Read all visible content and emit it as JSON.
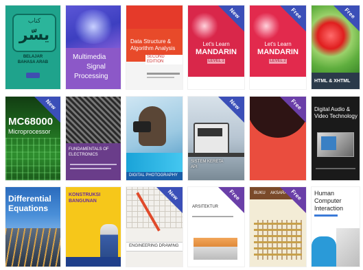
{
  "badges": {
    "new": "New",
    "free": "Free"
  },
  "books": [
    {
      "title_top": "كتاب",
      "title_main": "يسّر",
      "subtitle_1": "BELAJAR",
      "subtitle_2": "BAHASA ARAB"
    },
    {
      "title_line_1": "Multimedia",
      "title_line_2": "Signal",
      "title_line_3": "Processing"
    },
    {
      "title_line_1": "Data Structure &",
      "title_line_2": "Algorithm Analysis",
      "edition": "SECOND EDITION"
    },
    {
      "title_line_1": "Let's Learn",
      "title_line_2": "MANDARIN",
      "level": "LEVEL 1"
    },
    {
      "title_line_1": "Let's Learn",
      "title_line_2": "MANDARIN",
      "level": "LEVEL 2"
    },
    {
      "title": "HTML & XHTML"
    },
    {
      "title_line_1": "MC68000",
      "title_line_2": "Microprocessor"
    },
    {
      "title_line_1": "FUNDAMENTALS OF",
      "title_line_2": "ELECTRONICS"
    },
    {
      "title": "DIGITAL PHOTOGRAPHY"
    },
    {
      "title_line_1": "SISTEM KERETA",
      "title_line_2": "API"
    },
    {
      "title_line_1": "",
      "title_line_2": ""
    },
    {
      "title_line_1": "Digital Audio &",
      "title_line_2": "Video Technology"
    },
    {
      "title_line_1": "Differential",
      "title_line_2": "Equations"
    },
    {
      "title_line_1": "KONSTRUKSI",
      "title_line_2": "BANGUNAN"
    },
    {
      "title": "ENGINEERING DRAWING"
    },
    {
      "title_line_1": "ARSITEKTUR",
      "title_line_2": ""
    },
    {
      "title_line_1": "BUKU",
      "title_line_2": "AKSARA"
    },
    {
      "title_line_1": "Human",
      "title_line_2": "Computer",
      "title_line_3": "Interaction"
    }
  ]
}
